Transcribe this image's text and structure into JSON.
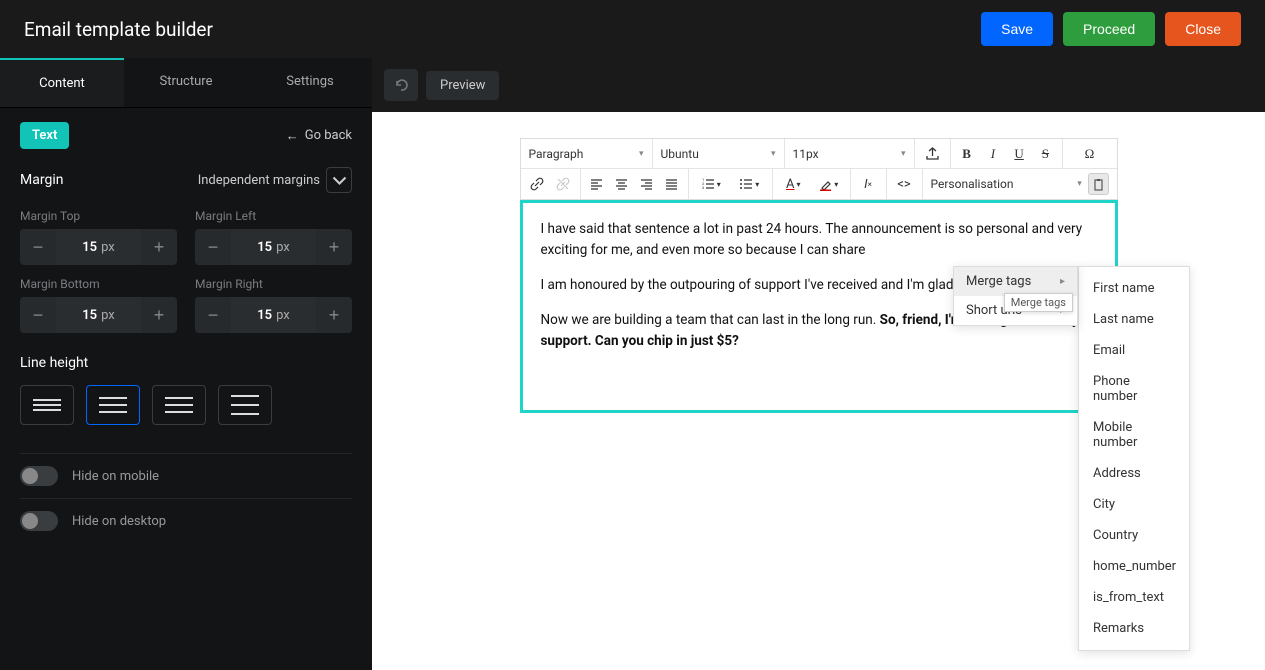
{
  "header": {
    "title": "Email template builder",
    "save": "Save",
    "proceed": "Proceed",
    "close": "Close"
  },
  "tabs": {
    "content": "Content",
    "structure": "Structure",
    "settings": "Settings"
  },
  "sidebar": {
    "chip": "Text",
    "goback": "Go back",
    "margin_label": "Margin",
    "independent": "Independent margins",
    "fields": [
      {
        "label": "Margin Top",
        "value": "15",
        "unit": "px"
      },
      {
        "label": "Margin Left",
        "value": "15",
        "unit": "px"
      },
      {
        "label": "Margin Bottom",
        "value": "15",
        "unit": "px"
      },
      {
        "label": "Margin Right",
        "value": "15",
        "unit": "px"
      }
    ],
    "lineheight": "Line height",
    "hide_mobile": "Hide on mobile",
    "hide_desktop": "Hide on desktop"
  },
  "toolbar_dark": {
    "preview": "Preview"
  },
  "rte": {
    "block": "Paragraph",
    "font": "Ubuntu",
    "size": "11px",
    "personalisation": "Personalisation"
  },
  "content": {
    "p1a": "I have said that sentence a lot in past 24 hours. The announcement is so personal and very exciting for me, and even more so because I can share",
    "p2": "I am honoured by the outpouring of support I've received and I'm glad you are by my side.",
    "p3a": "Now we are building a team that can last in the long run. ",
    "p3b": "So, friend, I'm writing to ask for yo",
    "p3c": "support. Can you chip in just $5?"
  },
  "dropdown1": {
    "merge_tags": "Merge tags",
    "short_urls": "Short urls",
    "tooltip": "Merge tags"
  },
  "dropdown2": {
    "items": [
      "First name",
      "Last name",
      "Email",
      "Phone number",
      "Mobile number",
      "Address",
      "City",
      "Country",
      "home_number",
      "is_from_text",
      "Remarks"
    ]
  }
}
